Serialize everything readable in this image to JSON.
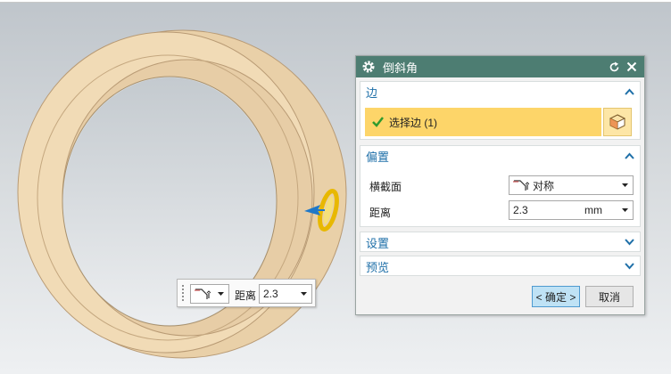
{
  "dialog": {
    "title": "倒斜角",
    "icons": {
      "settings": "gear-icon",
      "reset": "reset-icon",
      "close": "close-icon"
    },
    "sections": {
      "edge": {
        "header": "边",
        "select_label": "选择边 (1)",
        "select_icon": "checkmark-icon",
        "pick_icon": "cube-select-icon"
      },
      "offset": {
        "header": "偏置",
        "cross_section_label": "横截面",
        "cross_section_value": "对称",
        "distance_label": "距离",
        "distance_value": "2.3",
        "distance_unit": "mm"
      },
      "settings": {
        "header": "设置"
      },
      "preview": {
        "header": "预览"
      }
    },
    "buttons": {
      "ok": "< 确定 >",
      "cancel": "取消"
    }
  },
  "floating_toolbar": {
    "distance_label": "距离",
    "distance_value": "2.3"
  },
  "colors": {
    "titlebar": "#4d7d72",
    "section_header": "#1e6fa8",
    "selection_highlight": "#fdd569",
    "model_face": "#f0dcb8",
    "model_edge_highlight": "#f2c200"
  }
}
